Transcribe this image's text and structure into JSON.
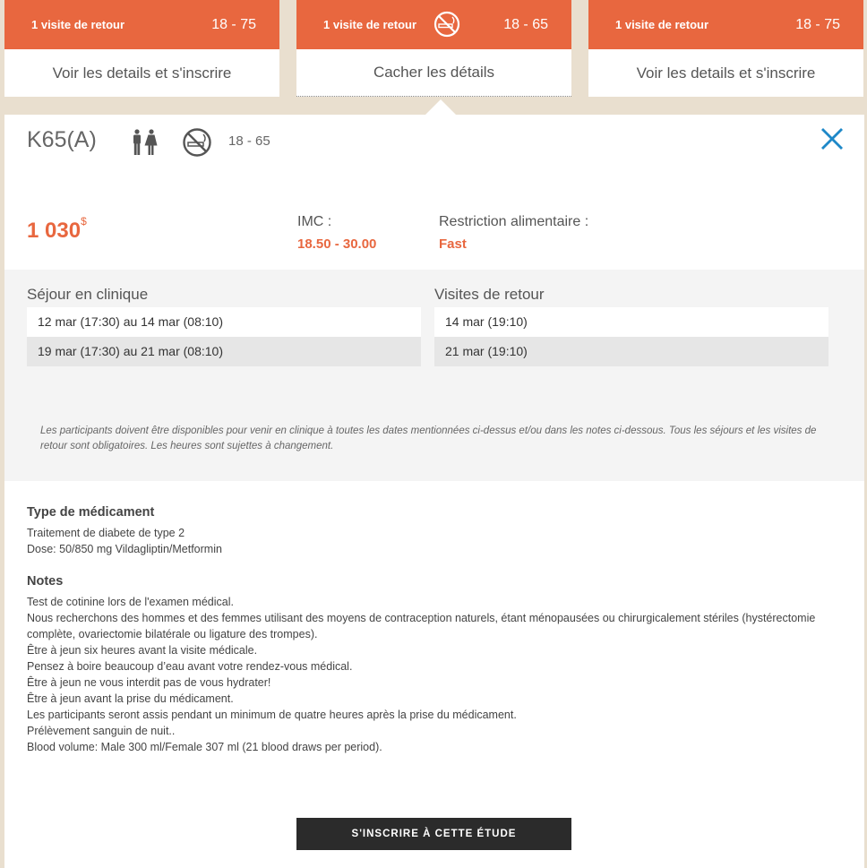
{
  "cards": [
    {
      "visits": "1 visite de retour",
      "age": "18 - 75",
      "action": "Voir les details et s'inscrire",
      "no_smoking": false
    },
    {
      "visits": "1 visite de retour",
      "age": "18 - 65",
      "action": "Cacher les détails",
      "no_smoking": true
    },
    {
      "visits": "1 visite de retour",
      "age": "18 - 75",
      "action": "Voir les details et s'inscrire",
      "no_smoking": false
    }
  ],
  "detail": {
    "study_code": "K65(A)",
    "gender_icon": "male-female-icon",
    "no_smoking_icon": "no-smoking-icon",
    "age_range": "18 - 65",
    "close_icon": "close-icon",
    "price": "1 030",
    "currency": "$",
    "imc_label": "IMC :",
    "imc_value": "18.50 - 30.00",
    "diet_label": "Restriction alimentaire :",
    "diet_value": "Fast"
  },
  "schedule": {
    "clinic_title": "Séjour en clinique",
    "clinic_dates": [
      "12 mar (17:30) au 14 mar (08:10)",
      "19 mar (17:30) au 21 mar (08:10)"
    ],
    "return_title": "Visites de retour",
    "return_dates": [
      "14 mar (19:10)",
      "21 mar (19:10)"
    ],
    "disclaimer": "Les participants doivent être disponibles pour venir en clinique à toutes les dates mentionnées ci-dessus et/ou dans les notes ci-dessous. Tous les séjours et les visites de retour sont obligatoires. Les heures sont sujettes à changement."
  },
  "medication": {
    "title": "Type de médicament",
    "lines": [
      "Traitement de diabete de type 2",
      "Dose: 50/850 mg Vildagliptin/Metformin"
    ]
  },
  "notes": {
    "title": "Notes",
    "lines": [
      "Test de cotinine lors de l'examen médical.",
      "Nous recherchons des hommes et des femmes utilisant des moyens de contraception naturels, étant ménopausées ou chirurgicalement stériles (hystérectomie complète, ovariectomie bilatérale ou ligature des trompes).",
      "Être à jeun six heures avant la visite médicale.",
      "Pensez à boire beaucoup d’eau avant votre rendez-vous médical.",
      "Être à jeun ne vous interdit pas de vous hydrater!",
      "Être à jeun avant la prise du médicament.",
      "Les participants seront assis pendant un minimum de quatre heures après la prise du médicament.",
      "Prélèvement sanguin de nuit..",
      "Blood volume: Male 300 ml/Female 307 ml (21 blood draws per period)."
    ]
  },
  "register_label": "S'INSCRIRE À CETTE ÉTUDE",
  "colors": {
    "accent": "#e8673f",
    "close": "#1e88c8",
    "background": "#e9dfcf",
    "button": "#2b2b2b"
  }
}
